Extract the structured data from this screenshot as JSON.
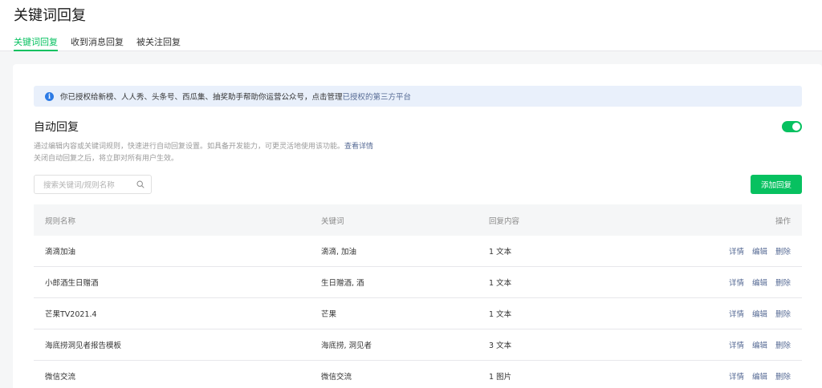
{
  "header": {
    "title": "关键词回复",
    "tabs": [
      {
        "label": "关键词回复",
        "active": true
      },
      {
        "label": "收到消息回复",
        "active": false
      },
      {
        "label": "被关注回复",
        "active": false
      }
    ]
  },
  "notice": {
    "icon": "info-icon",
    "icon_glyph": "i",
    "text": "你已授权给新榜、人人秀、头条号、西瓜集、抽奖助手帮助你运营公众号，点击管理",
    "link": "已授权的第三方平台"
  },
  "auto_reply": {
    "title": "自动回复",
    "desc1": "通过编辑内容或关键词规则，快速进行自动回复设置。如具备开发能力，可更灵活地使用该功能。",
    "desc1_link": "查看详情",
    "desc2": "关闭自动回复之后，将立即对所有用户生效。",
    "enabled": true
  },
  "search": {
    "placeholder": "搜索关键词/规则名称",
    "value": ""
  },
  "add_button": "添加回复",
  "table": {
    "headers": [
      "规则名称",
      "关键词",
      "回复内容",
      "操作"
    ],
    "actions": [
      "详情",
      "编辑",
      "删除"
    ],
    "rows": [
      {
        "name": "滴滴加油",
        "keywords": "滴滴, 加油",
        "content": "1 文本"
      },
      {
        "name": "小郎酒生日赠酒",
        "keywords": "生日赠酒, 酒",
        "content": "1 文本"
      },
      {
        "name": "芒果TV2021.4",
        "keywords": "芒果",
        "content": "1 文本"
      },
      {
        "name": "海底捞洞见者报告模板",
        "keywords": "海底捞, 洞见者",
        "content": "3 文本"
      },
      {
        "name": "微信交流",
        "keywords": "微信交流",
        "content": "1 图片"
      }
    ]
  },
  "colors": {
    "accent": "#07c160",
    "link": "#576b95",
    "info": "#2d7be5"
  }
}
